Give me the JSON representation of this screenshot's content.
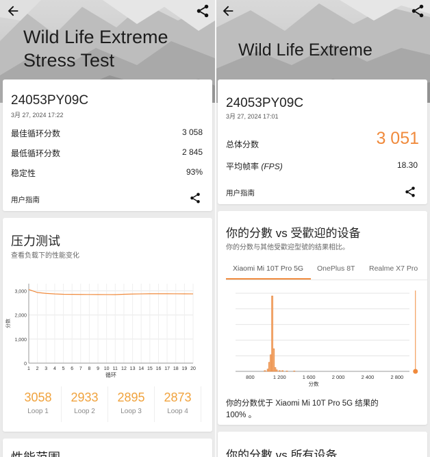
{
  "left": {
    "title_line1": "Wild Life Extreme",
    "title_line2": "Stress Test",
    "device": "24053PY09C",
    "date": "3月 27, 2024 17:22",
    "rows": [
      {
        "label": "最佳循环分数",
        "value": "3 058"
      },
      {
        "label": "最低循环分数",
        "value": "2 845"
      },
      {
        "label": "稳定性",
        "value": "93%"
      }
    ],
    "guide": "用户指南",
    "stress": {
      "heading": "压力测试",
      "sub": "查看负载下的性能变化",
      "chart_ylabel": "分数",
      "chart_xlabel": "循环"
    },
    "loops": [
      {
        "value": "3058",
        "label": "Loop 1"
      },
      {
        "value": "2933",
        "label": "Loop 2"
      },
      {
        "value": "2895",
        "label": "Loop 3"
      },
      {
        "value": "2873",
        "label": "Loop 4"
      }
    ],
    "next_heading": "性能范围"
  },
  "right": {
    "title": "Wild Life Extreme",
    "device": "24053PY09C",
    "date": "3月 27, 2024 17:01",
    "total_label": "总体分数",
    "total_value": "3 051",
    "fps_label": "平均帧率",
    "fps_unit": "(FPS)",
    "fps_value": "18.30",
    "guide": "用户指南",
    "compare": {
      "heading": "你的分數 vs 受歡迎的设备",
      "sub": "你的分数与其他受歡迎型號的结果相比。",
      "tabs": [
        "Xiaomi Mi 10T Pro 5G",
        "OnePlus 8T",
        "Realme X7 Pro"
      ],
      "chart_xlabel": "分数",
      "result_line1": "你的分数优于 Xiaomi Mi 10T Pro 5G 结果的",
      "result_line2": "100% 。"
    },
    "next_heading": "你的分數 vs 所有设备"
  },
  "colors": {
    "accent": "#f08a3c",
    "loop_accent": "#f0a23c",
    "bar_fill": "#f8b27c"
  },
  "chart_data": [
    {
      "type": "line",
      "title": "",
      "xlabel": "循环",
      "ylabel": "分数",
      "x": [
        1,
        2,
        3,
        4,
        5,
        6,
        7,
        8,
        9,
        10,
        11,
        12,
        13,
        14,
        15,
        16,
        17,
        18,
        19,
        20
      ],
      "series": [
        {
          "values": [
            3058,
            2933,
            2895,
            2873,
            2860,
            2855,
            2852,
            2850,
            2848,
            2846,
            2845,
            2860,
            2870,
            2875,
            2880,
            2880,
            2880,
            2878,
            2876,
            2875
          ]
        }
      ],
      "xticks": [
        "1",
        "2",
        "3",
        "4",
        "5",
        "6",
        "7",
        "8",
        "9",
        "10",
        "11",
        "12",
        "13",
        "14",
        "15",
        "16",
        "17",
        "18",
        "19",
        "20"
      ],
      "yticks": [
        "0",
        "1,000",
        "2,000",
        "3,000"
      ],
      "ylim": [
        0,
        3300
      ],
      "grid": true
    },
    {
      "type": "bar",
      "title": "",
      "xlabel": "分数",
      "xticks": [
        "800",
        "1 200",
        "1 600",
        "2 000",
        "2 400",
        "2 800"
      ],
      "xlim": [
        600,
        3100
      ],
      "bins": [
        {
          "x": 1000,
          "v": 0.01
        },
        {
          "x": 1040,
          "v": 0.03
        },
        {
          "x": 1060,
          "v": 0.12
        },
        {
          "x": 1080,
          "v": 0.22
        },
        {
          "x": 1100,
          "v": 1.0
        },
        {
          "x": 1120,
          "v": 0.3
        },
        {
          "x": 1140,
          "v": 0.05
        },
        {
          "x": 1160,
          "v": 0.02
        },
        {
          "x": 1200,
          "v": 0.01
        },
        {
          "x": 1240,
          "v": 0.01
        },
        {
          "x": 1300,
          "v": 0.005
        },
        {
          "x": 1400,
          "v": 0.005
        }
      ],
      "your_score": 3051,
      "grid": true
    }
  ]
}
